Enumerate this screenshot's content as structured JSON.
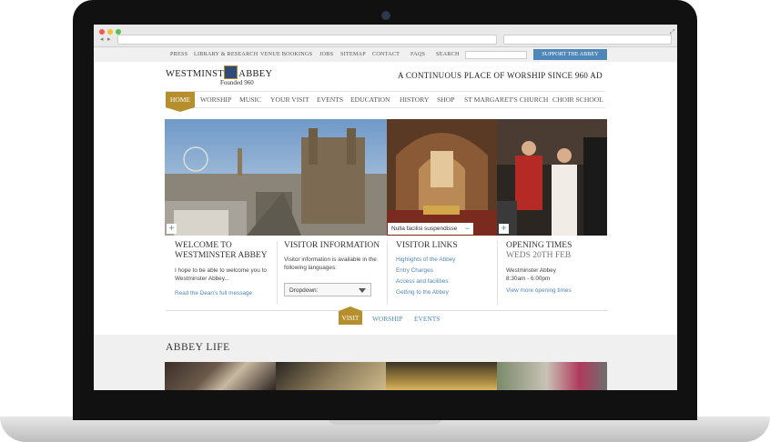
{
  "top_nav": {
    "items": [
      "PRESS",
      "LIBRARY & RESEARCH",
      "VENUE BOOKINGS",
      "JOBS",
      "SITEMAP",
      "CONTACT",
      "FAQS",
      "SEARCH"
    ],
    "support_label": "SUPPORT THE ABBEY"
  },
  "header": {
    "logo_text": "WESTMINSTER ABBEY",
    "founded": "Founded 960",
    "tagline": "A CONTINUOUS  PLACE OF WORSHIP SINCE 960 AD"
  },
  "main_nav": {
    "home": "HOME",
    "items": [
      "WORSHIP",
      "MUSIC",
      "YOUR VISIT",
      "EVENTS",
      "EDUCATION",
      "HISTORY",
      "SHOP",
      "ST MARGARET'S CHURCH",
      "CHOIR SCHOOL"
    ]
  },
  "hero": {
    "plus_symbol": "+",
    "minus_symbol": "−",
    "caption": "Nulla facilisi suspendisse"
  },
  "welcome": {
    "title_line1": "WELCOME TO",
    "title_line2": "WESTMINSTER ABBEY",
    "body": "I hope to be able to welcome you to Westminster Abbey...",
    "link": "Read the Dean's full message"
  },
  "visitor_info": {
    "title": "VISITOR INFORMATION",
    "body": "Visitor information is available in the following languages:",
    "dropdown_label": "Dropdown:"
  },
  "visitor_links": {
    "title": "VISITOR LINKS",
    "links": [
      "Highlights of the Abbey",
      "Entry Charges",
      "Access and facilities",
      "Getting to the Abbey"
    ]
  },
  "opening_times": {
    "title": "OPENING TIMES",
    "date": "WEDS 20TH FEB",
    "place": "Westminster Abbey",
    "hours": "8:30am - 6:00pm",
    "link": "View more opening times"
  },
  "tabs": {
    "active": "VISIT",
    "items": [
      "WORSHIP",
      "EVENTS"
    ]
  },
  "abbey_life": {
    "title": "ABBEY LIFE"
  },
  "colors": {
    "gold": "#b58e2e",
    "link_blue": "#4f88b8",
    "support_blue": "#4f88b8"
  }
}
